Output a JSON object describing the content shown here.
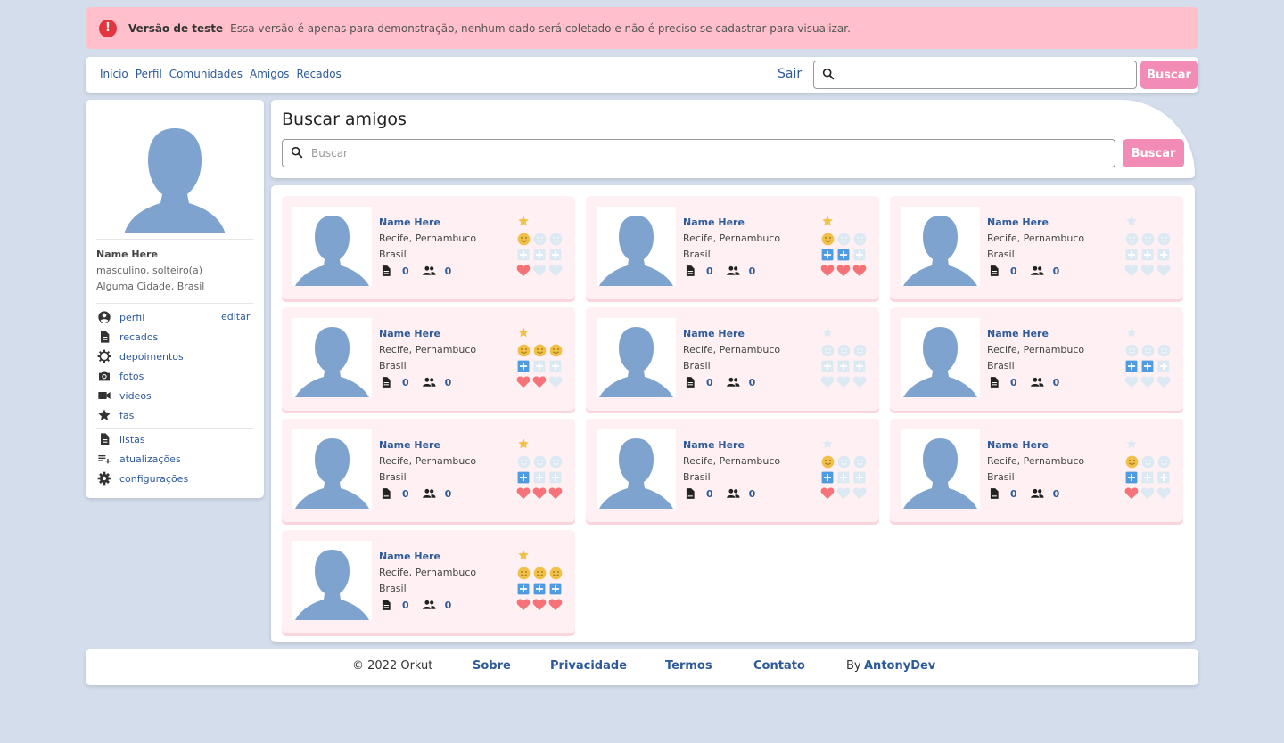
{
  "alert": {
    "title": "Versão de teste",
    "text": "Essa versão é apenas para demonstração, nenhum dado será coletado e não é preciso se cadastrar para visualizar."
  },
  "nav": {
    "links": [
      "Início",
      "Perfil",
      "Comunidades",
      "Amigos",
      "Recados"
    ],
    "logout": "Sair",
    "search_placeholder": "",
    "search_button": "Buscar"
  },
  "profile": {
    "name": "Name Here",
    "info_line1": "masculino, solteiro(a)",
    "info_line2": "Alguma Cidade, Brasil",
    "edit_link": "editar",
    "menu": [
      {
        "label": "perfil",
        "icon": "account-circle-icon"
      },
      {
        "label": "recados",
        "icon": "document-icon"
      },
      {
        "label": "depoimentos",
        "icon": "gear-badge-icon"
      },
      {
        "label": "fotos",
        "icon": "camera-icon"
      },
      {
        "label": "videos",
        "icon": "video-camera-icon"
      },
      {
        "label": "fãs",
        "icon": "star-icon"
      }
    ],
    "menu2": [
      {
        "label": "listas",
        "icon": "document-icon"
      },
      {
        "label": "atualizações",
        "icon": "playlist-add-icon"
      },
      {
        "label": "configurações",
        "icon": "settings-icon"
      }
    ]
  },
  "search": {
    "title": "Buscar amigos",
    "placeholder": "Buscar",
    "button": "Buscar"
  },
  "colors": {
    "accent_pink": "#f28cb6",
    "link_blue": "#2e5a99",
    "avatar_blue": "#7fa3cf",
    "star_active": "#f0c04a",
    "plus_active": "#4f9be0",
    "heart_active": "#f57378",
    "inactive": "#dce8f2"
  },
  "friends": [
    {
      "name": "Name Here",
      "city": "Recife, Pernambuco",
      "country": "Brasil",
      "scraps": "0",
      "friends": "0",
      "star": 1,
      "smile": 1,
      "plus": 0,
      "heart": 1
    },
    {
      "name": "Name Here",
      "city": "Recife, Pernambuco",
      "country": "Brasil",
      "scraps": "0",
      "friends": "0",
      "star": 1,
      "smile": 1,
      "plus": 2,
      "heart": 3
    },
    {
      "name": "Name Here",
      "city": "Recife, Pernambuco",
      "country": "Brasil",
      "scraps": "0",
      "friends": "0",
      "star": 0,
      "smile": 0,
      "plus": 0,
      "heart": 0
    },
    {
      "name": "Name Here",
      "city": "Recife, Pernambuco",
      "country": "Brasil",
      "scraps": "0",
      "friends": "0",
      "star": 1,
      "smile": 3,
      "plus": 1,
      "heart": 2
    },
    {
      "name": "Name Here",
      "city": "Recife, Pernambuco",
      "country": "Brasil",
      "scraps": "0",
      "friends": "0",
      "star": 0,
      "smile": 0,
      "plus": 0,
      "heart": 0
    },
    {
      "name": "Name Here",
      "city": "Recife, Pernambuco",
      "country": "Brasil",
      "scraps": "0",
      "friends": "0",
      "star": 0,
      "smile": 0,
      "plus": 2,
      "heart": 0
    },
    {
      "name": "Name Here",
      "city": "Recife, Pernambuco",
      "country": "Brasil",
      "scraps": "0",
      "friends": "0",
      "star": 1,
      "smile": 0,
      "plus": 1,
      "heart": 3
    },
    {
      "name": "Name Here",
      "city": "Recife, Pernambuco",
      "country": "Brasil",
      "scraps": "0",
      "friends": "0",
      "star": 0,
      "smile": 1,
      "plus": 1,
      "heart": 1
    },
    {
      "name": "Name Here",
      "city": "Recife, Pernambuco",
      "country": "Brasil",
      "scraps": "0",
      "friends": "0",
      "star": 0,
      "smile": 1,
      "plus": 1,
      "heart": 1
    },
    {
      "name": "Name Here",
      "city": "Recife, Pernambuco",
      "country": "Brasil",
      "scraps": "0",
      "friends": "0",
      "star": 1,
      "smile": 3,
      "plus": 3,
      "heart": 3
    }
  ],
  "footer": {
    "copyright": "© 2022 Orkut",
    "links": [
      "Sobre",
      "Privacidade",
      "Termos",
      "Contato"
    ],
    "by_prefix": "By",
    "author": "AntonyDev"
  }
}
